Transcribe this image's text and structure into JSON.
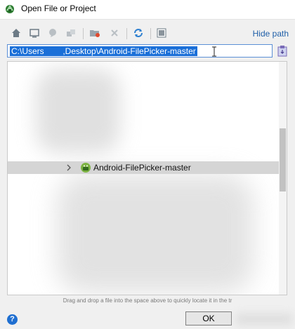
{
  "window": {
    "title": "Open File or Project"
  },
  "toolbar": {
    "icons": [
      "home-icon",
      "desktop-icon",
      "project-icon",
      "module-icon",
      "new-folder-icon",
      "delete-icon",
      "refresh-icon",
      "show-hidden-icon"
    ],
    "hide_path_label": "Hide path"
  },
  "path": {
    "value": "C:\\Users        ,Desktop\\Android-FilePicker-master"
  },
  "tree": {
    "selected_item": {
      "label": "Android-FilePicker-master",
      "icon": "android-project-icon",
      "expanded": false
    }
  },
  "hint": {
    "text": "Drag and drop a file into the space above to quickly locate it in the tr"
  },
  "footer": {
    "help_label": "?",
    "ok_label": "OK"
  },
  "colors": {
    "selection": "#1a6fd8",
    "link": "#1f5fa8",
    "tree_row_highlight": "#d5d5d5",
    "android_green": "#7cb342"
  }
}
